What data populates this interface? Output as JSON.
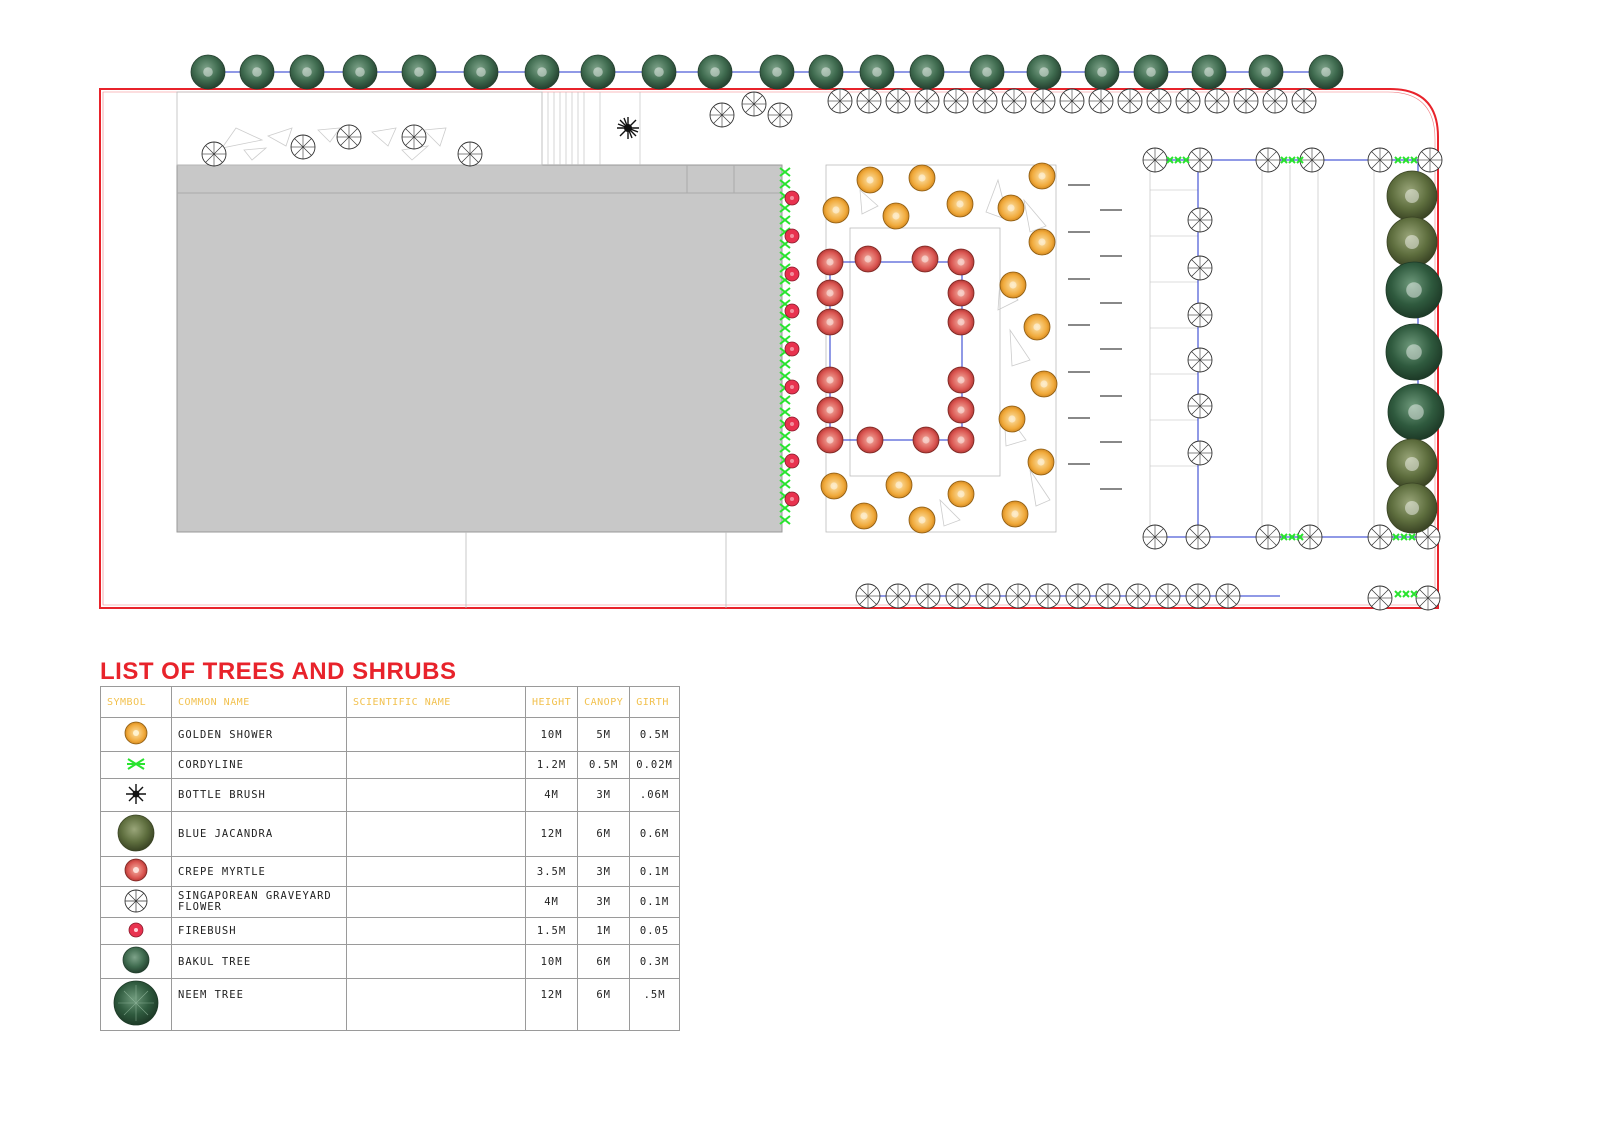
{
  "legend": {
    "title": "LIST OF TREES AND SHRUBS",
    "headers": [
      "SYMBOL",
      "COMMON NAME",
      "SCIENTIFIC NAME",
      "HEIGHT",
      "CANOPY",
      "GIRTH"
    ],
    "rows": [
      {
        "symbol": "golden-shower-icon",
        "name": "GOLDEN SHOWER",
        "scientific": "",
        "height": "10M",
        "canopy": "5M",
        "girth": "0.5M"
      },
      {
        "symbol": "cordyline-icon",
        "name": "CORDYLINE",
        "scientific": "",
        "height": "1.2M",
        "canopy": "0.5M",
        "girth": "0.02M"
      },
      {
        "symbol": "bottle-brush-icon",
        "name": "BOTTLE BRUSH",
        "scientific": "",
        "height": "4M",
        "canopy": "3M",
        "girth": ".06M"
      },
      {
        "symbol": "blue-jacandra-icon",
        "name": "BLUE JACANDRA",
        "scientific": "",
        "height": "12M",
        "canopy": "6M",
        "girth": "0.6M"
      },
      {
        "symbol": "crepe-myrtle-icon",
        "name": "CREPE MYRTLE",
        "scientific": "",
        "height": "3.5M",
        "canopy": "3M",
        "girth": "0.1M"
      },
      {
        "symbol": "singaporean-graveyard-flower-icon",
        "name": "SINGAPOREAN GRAVEYARD FLOWER",
        "scientific": "",
        "height": "4M",
        "canopy": "3M",
        "girth": "0.1M"
      },
      {
        "symbol": "firebush-icon",
        "name": "FIREBUSH",
        "scientific": "",
        "height": "1.5M",
        "canopy": "1M",
        "girth": "0.05"
      },
      {
        "symbol": "bakul-tree-icon",
        "name": "BAKUL TREE",
        "scientific": "",
        "height": "10M",
        "canopy": "6M",
        "girth": "0.3M"
      },
      {
        "symbol": "neem-tree-icon",
        "name": "NEEM TREE",
        "scientific": "",
        "height": "12M",
        "canopy": "6M",
        "girth": ".5M"
      }
    ]
  },
  "colors": {
    "site_boundary": "#e8232b",
    "building": "#c8c8c8",
    "golden_shower": "#f0a93a",
    "crepe_myrtle": "#d9534f",
    "cordyline": "#29e32f",
    "bakul": "#3f6b4f",
    "blue_jacandra": "#5e6e3e",
    "neem": "#2f5a3e",
    "path_line": "#2233cc",
    "header_text": "#f2c14e"
  }
}
